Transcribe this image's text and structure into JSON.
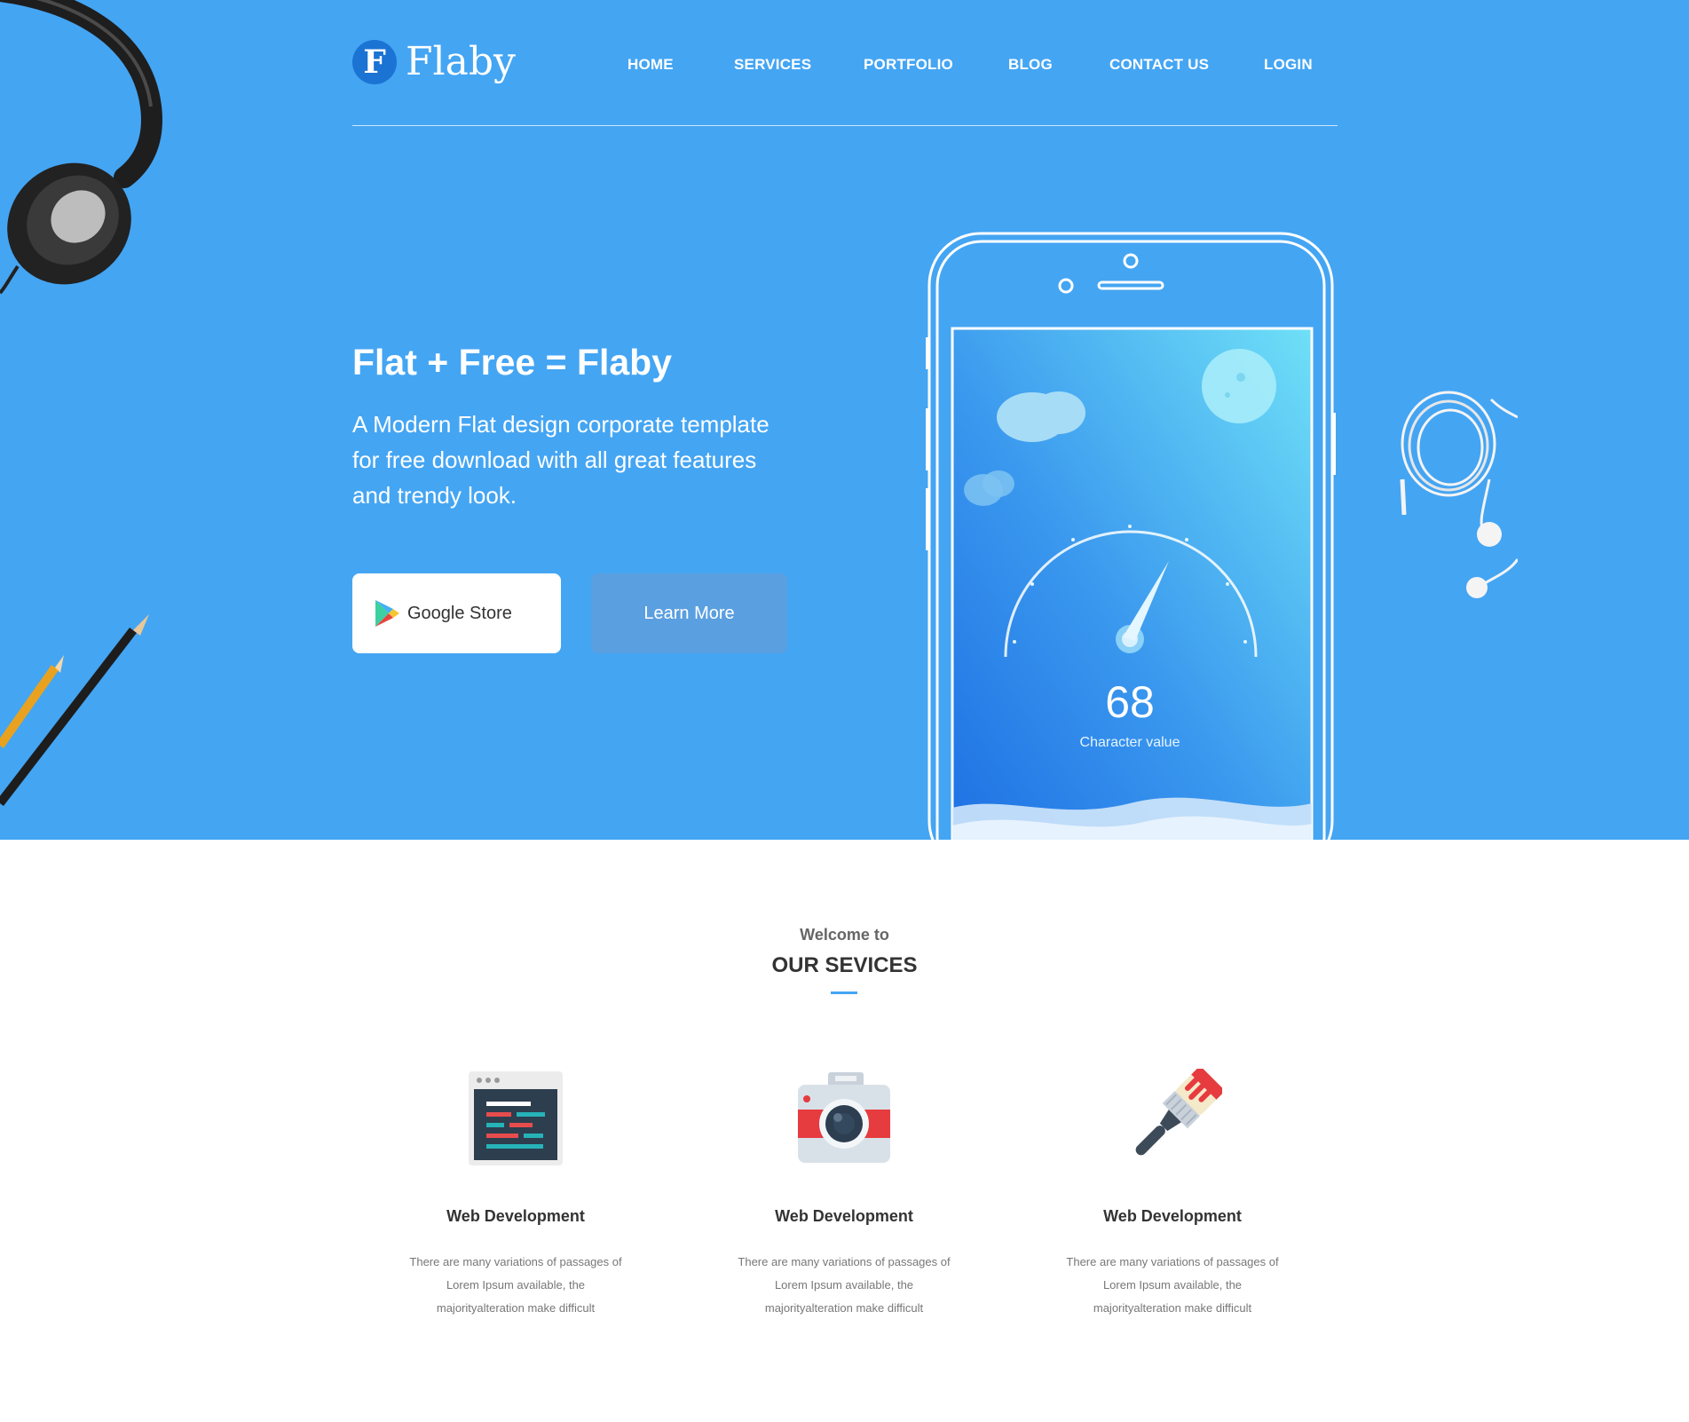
{
  "brand": {
    "letter": "F",
    "name": "Flaby"
  },
  "nav": {
    "items": [
      {
        "label": "HOME"
      },
      {
        "label": "SERVICES"
      },
      {
        "label": "PORTFOLIO"
      },
      {
        "label": "BLOG"
      },
      {
        "label": "CONTACT US"
      },
      {
        "label": "LOGIN"
      }
    ]
  },
  "hero": {
    "title": "Flat + Free = Flaby",
    "description": "A Modern Flat design corporate template for free download with all great features and trendy look.",
    "google_button": "Google Store",
    "learn_button": "Learn More",
    "phone": {
      "value": "68",
      "caption": "Character value"
    }
  },
  "services": {
    "kicker": "Welcome to",
    "title": "OUR SEVICES",
    "items": [
      {
        "icon": "code-window-icon",
        "title": "Web Development",
        "description": "There are many variations of passages of Lorem Ipsum available, the majorityalteration make difficult"
      },
      {
        "icon": "camera-icon",
        "title": "Web Development",
        "description": "There are many variations of passages of Lorem Ipsum available, the majorityalteration make difficult"
      },
      {
        "icon": "paint-brush-icon",
        "title": "Web Development",
        "description": "There are many variations of passages of Lorem Ipsum available, the majorityalteration make difficult"
      }
    ]
  },
  "colors": {
    "hero_bg": "#44a5f3",
    "accent": "#1b73d3",
    "learn_button": "#5a9fe0"
  }
}
